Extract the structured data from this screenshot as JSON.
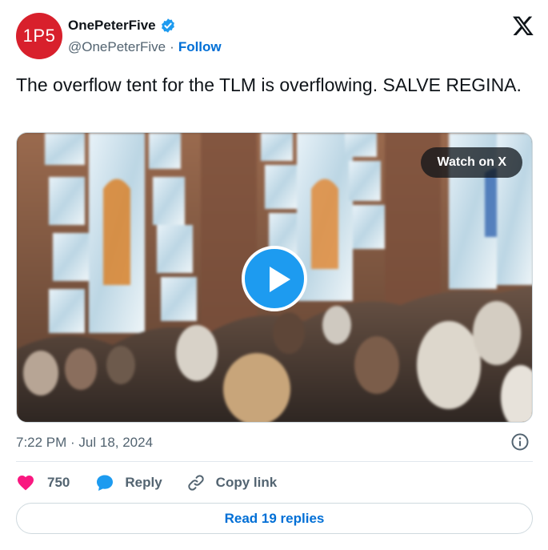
{
  "author": {
    "display_name": "OnePeterFive",
    "handle": "@OnePeterFive",
    "avatar_text": "1P5",
    "verified": true,
    "separator": "·",
    "follow_label": "Follow"
  },
  "platform_icon": "x-logo-icon",
  "tweet": {
    "text": "The overflow tent for the TLM is overflowing. SALVE REGINA."
  },
  "media": {
    "type": "video",
    "watch_label": "Watch on X",
    "play_icon": "play-icon"
  },
  "meta": {
    "timestamp": "7:22 PM · Jul 18, 2024",
    "info_icon": "info-icon"
  },
  "actions": {
    "like_count": "750",
    "reply_label": "Reply",
    "copy_link_label": "Copy link"
  },
  "read_replies_label": "Read 19 replies",
  "colors": {
    "accent": "#1d9bf0",
    "link": "#006fd6",
    "like": "#f91880",
    "avatar_bg": "#d8202c",
    "muted_text": "#536471"
  }
}
